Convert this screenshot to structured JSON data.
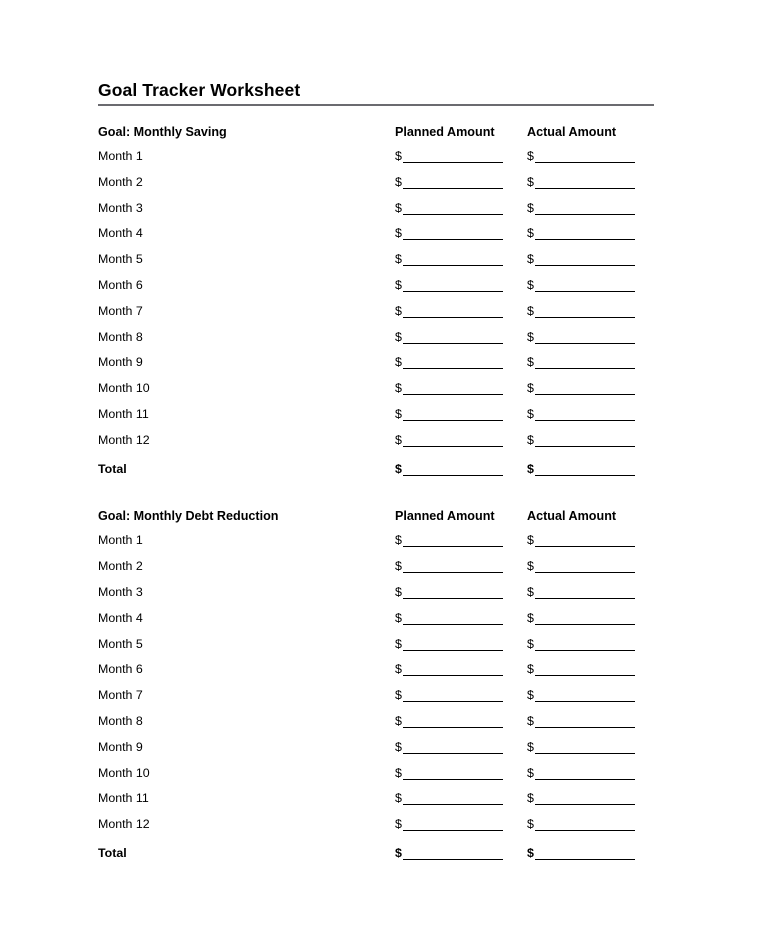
{
  "document": {
    "title": "Goal Tracker Worksheet"
  },
  "columns": {
    "label_blank": "",
    "planned": "Planned Amount",
    "actual": "Actual Amount"
  },
  "currency_symbol": "$",
  "sections": [
    {
      "heading": "Goal: Monthly Saving",
      "rows": [
        {
          "label": "Month 1"
        },
        {
          "label": "Month 2"
        },
        {
          "label": "Month 3"
        },
        {
          "label": "Month 4"
        },
        {
          "label": "Month 5"
        },
        {
          "label": "Month 6"
        },
        {
          "label": "Month 7"
        },
        {
          "label": "Month 8"
        },
        {
          "label": "Month 9"
        },
        {
          "label": "Month 10"
        },
        {
          "label": "Month 11"
        },
        {
          "label": "Month 12"
        }
      ],
      "total_label": "Total"
    },
    {
      "heading": "Goal: Monthly Debt Reduction",
      "rows": [
        {
          "label": "Month 1"
        },
        {
          "label": "Month 2"
        },
        {
          "label": "Month 3"
        },
        {
          "label": "Month 4"
        },
        {
          "label": "Month 5"
        },
        {
          "label": "Month 6"
        },
        {
          "label": "Month 7"
        },
        {
          "label": "Month 8"
        },
        {
          "label": "Month 9"
        },
        {
          "label": "Month 10"
        },
        {
          "label": "Month 11"
        },
        {
          "label": "Month 12"
        }
      ],
      "total_label": "Total"
    }
  ],
  "colors": {
    "text": "#000000",
    "rule": "#6b6b70",
    "field_line": "#000000",
    "background": "#ffffff"
  }
}
